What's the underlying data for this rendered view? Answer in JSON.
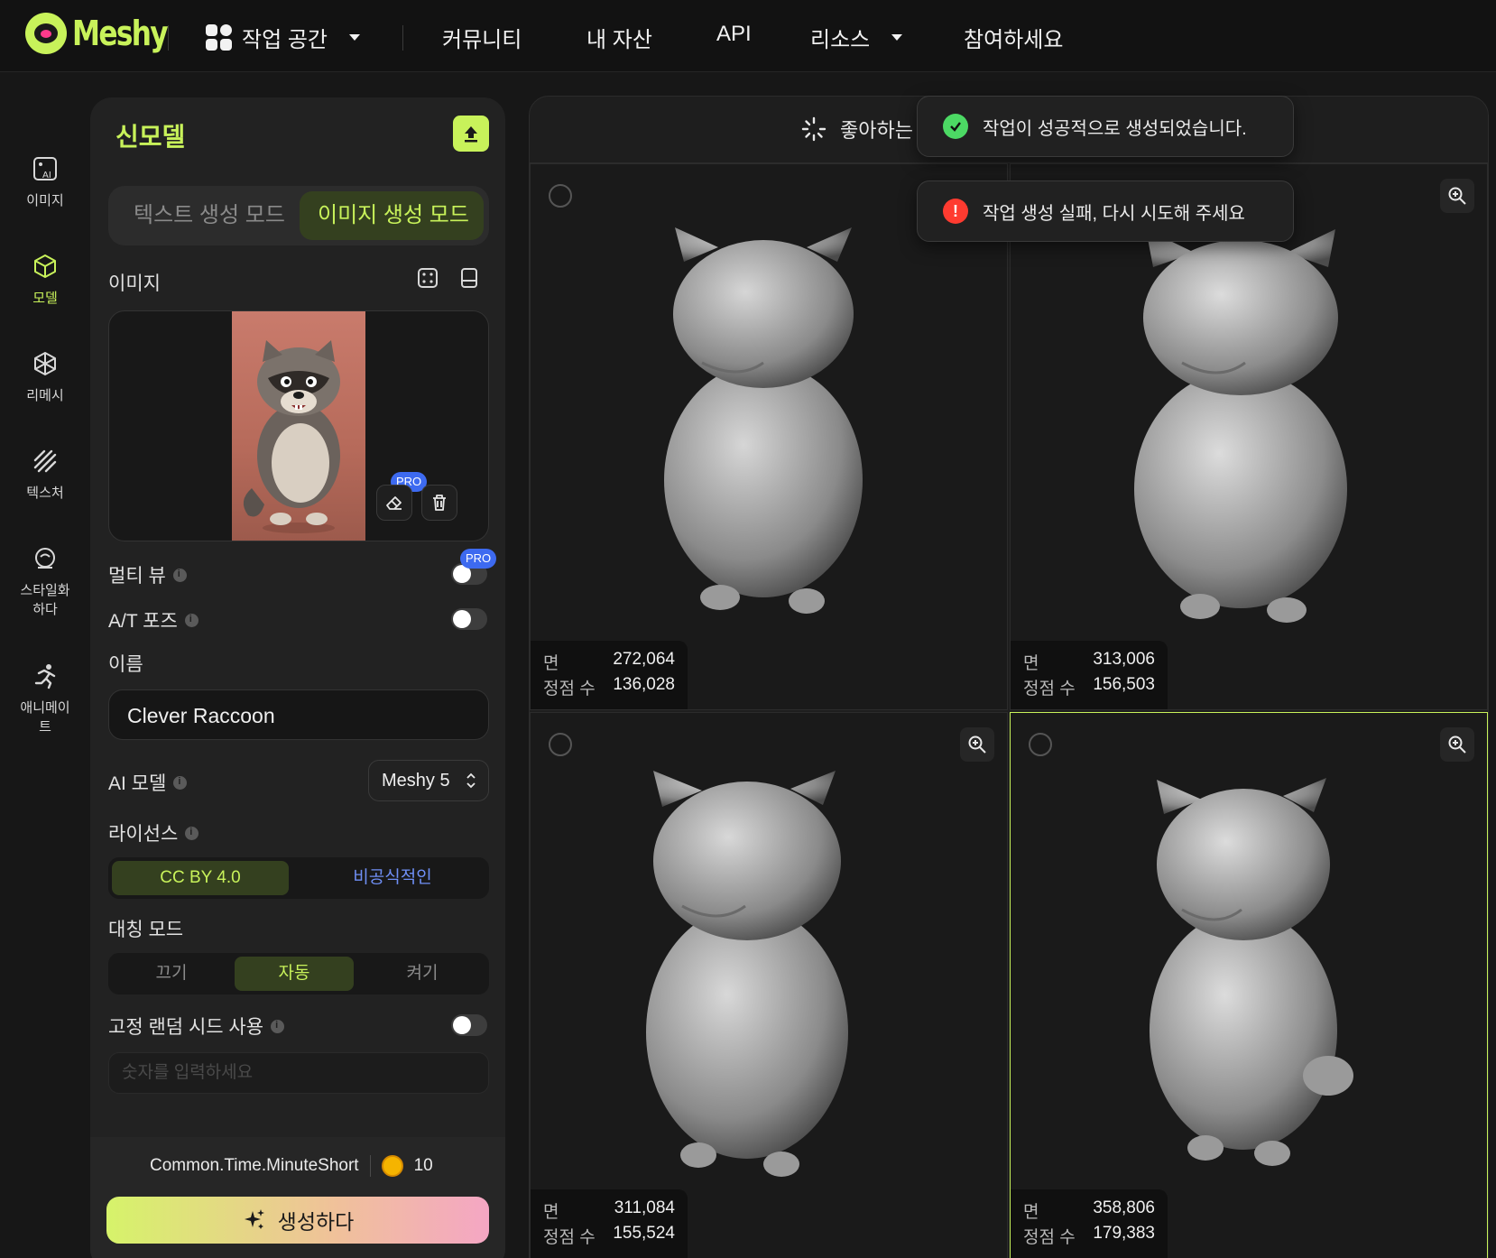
{
  "header": {
    "brand": "Meshy",
    "nav": [
      {
        "label": "작업 공간",
        "dropdown": true
      },
      {
        "label": "커뮤니티"
      },
      {
        "label": "내 자산"
      },
      {
        "label": "API"
      },
      {
        "label": "리소스",
        "dropdown": true
      },
      {
        "label": "참여하세요"
      }
    ]
  },
  "rail": {
    "items": [
      {
        "label": "이미지",
        "icon": "ai-image-icon"
      },
      {
        "label": "모델",
        "icon": "cube-icon",
        "active": true
      },
      {
        "label": "리메시",
        "icon": "remesh-icon"
      },
      {
        "label": "텍스처",
        "icon": "texture-icon"
      },
      {
        "label_line1": "스타일화",
        "label_line2": "하다",
        "icon": "stylize-icon"
      },
      {
        "label_line1": "애니메이",
        "label_line2": "트",
        "icon": "running-figure-icon"
      }
    ]
  },
  "panel": {
    "title": "신모델",
    "mode_tabs": {
      "text_mode": "텍스트 생성 모드",
      "image_mode": "이미지 생성 모드"
    },
    "image_label": "이미지",
    "pro_badge": "PRO",
    "multi_view_label": "멀티 뷰",
    "at_pose_label": "A/T 포즈",
    "name_label": "이름",
    "name_value": "Clever Raccoon",
    "ai_model_label": "AI 모델",
    "ai_model_value": "Meshy 5",
    "license_label": "라이선스",
    "license_options": [
      "CC BY 4.0",
      "비공식적인"
    ],
    "symmetry_label": "대칭 모드",
    "symmetry_options": [
      "끄기",
      "자동",
      "켜기"
    ],
    "seed_label": "고정 랜덤 시드 사용",
    "seed_placeholder": "숫자를 입력하세요",
    "time_label": "Common.Time.MinuteShort",
    "credit_cost": "10",
    "generate_label": "생성하다"
  },
  "results": {
    "header_label": "좋아하는",
    "face_label": "면",
    "vertex_label": "정점 수",
    "models": [
      {
        "faces": "272,064",
        "vertices": "136,028"
      },
      {
        "faces": "313,006",
        "vertices": "156,503"
      },
      {
        "faces": "311,084",
        "vertices": "155,524"
      },
      {
        "faces": "358,806",
        "vertices": "179,383",
        "selected": true
      }
    ]
  },
  "toasts": {
    "success": "작업이 성공적으로 생성되었습니다.",
    "error": "작업 생성 실패, 다시 시도해 주세요"
  },
  "colors": {
    "accent": "#c8f25a",
    "success": "#4cd964",
    "error": "#ff3b30",
    "pro": "#3d6af0"
  }
}
